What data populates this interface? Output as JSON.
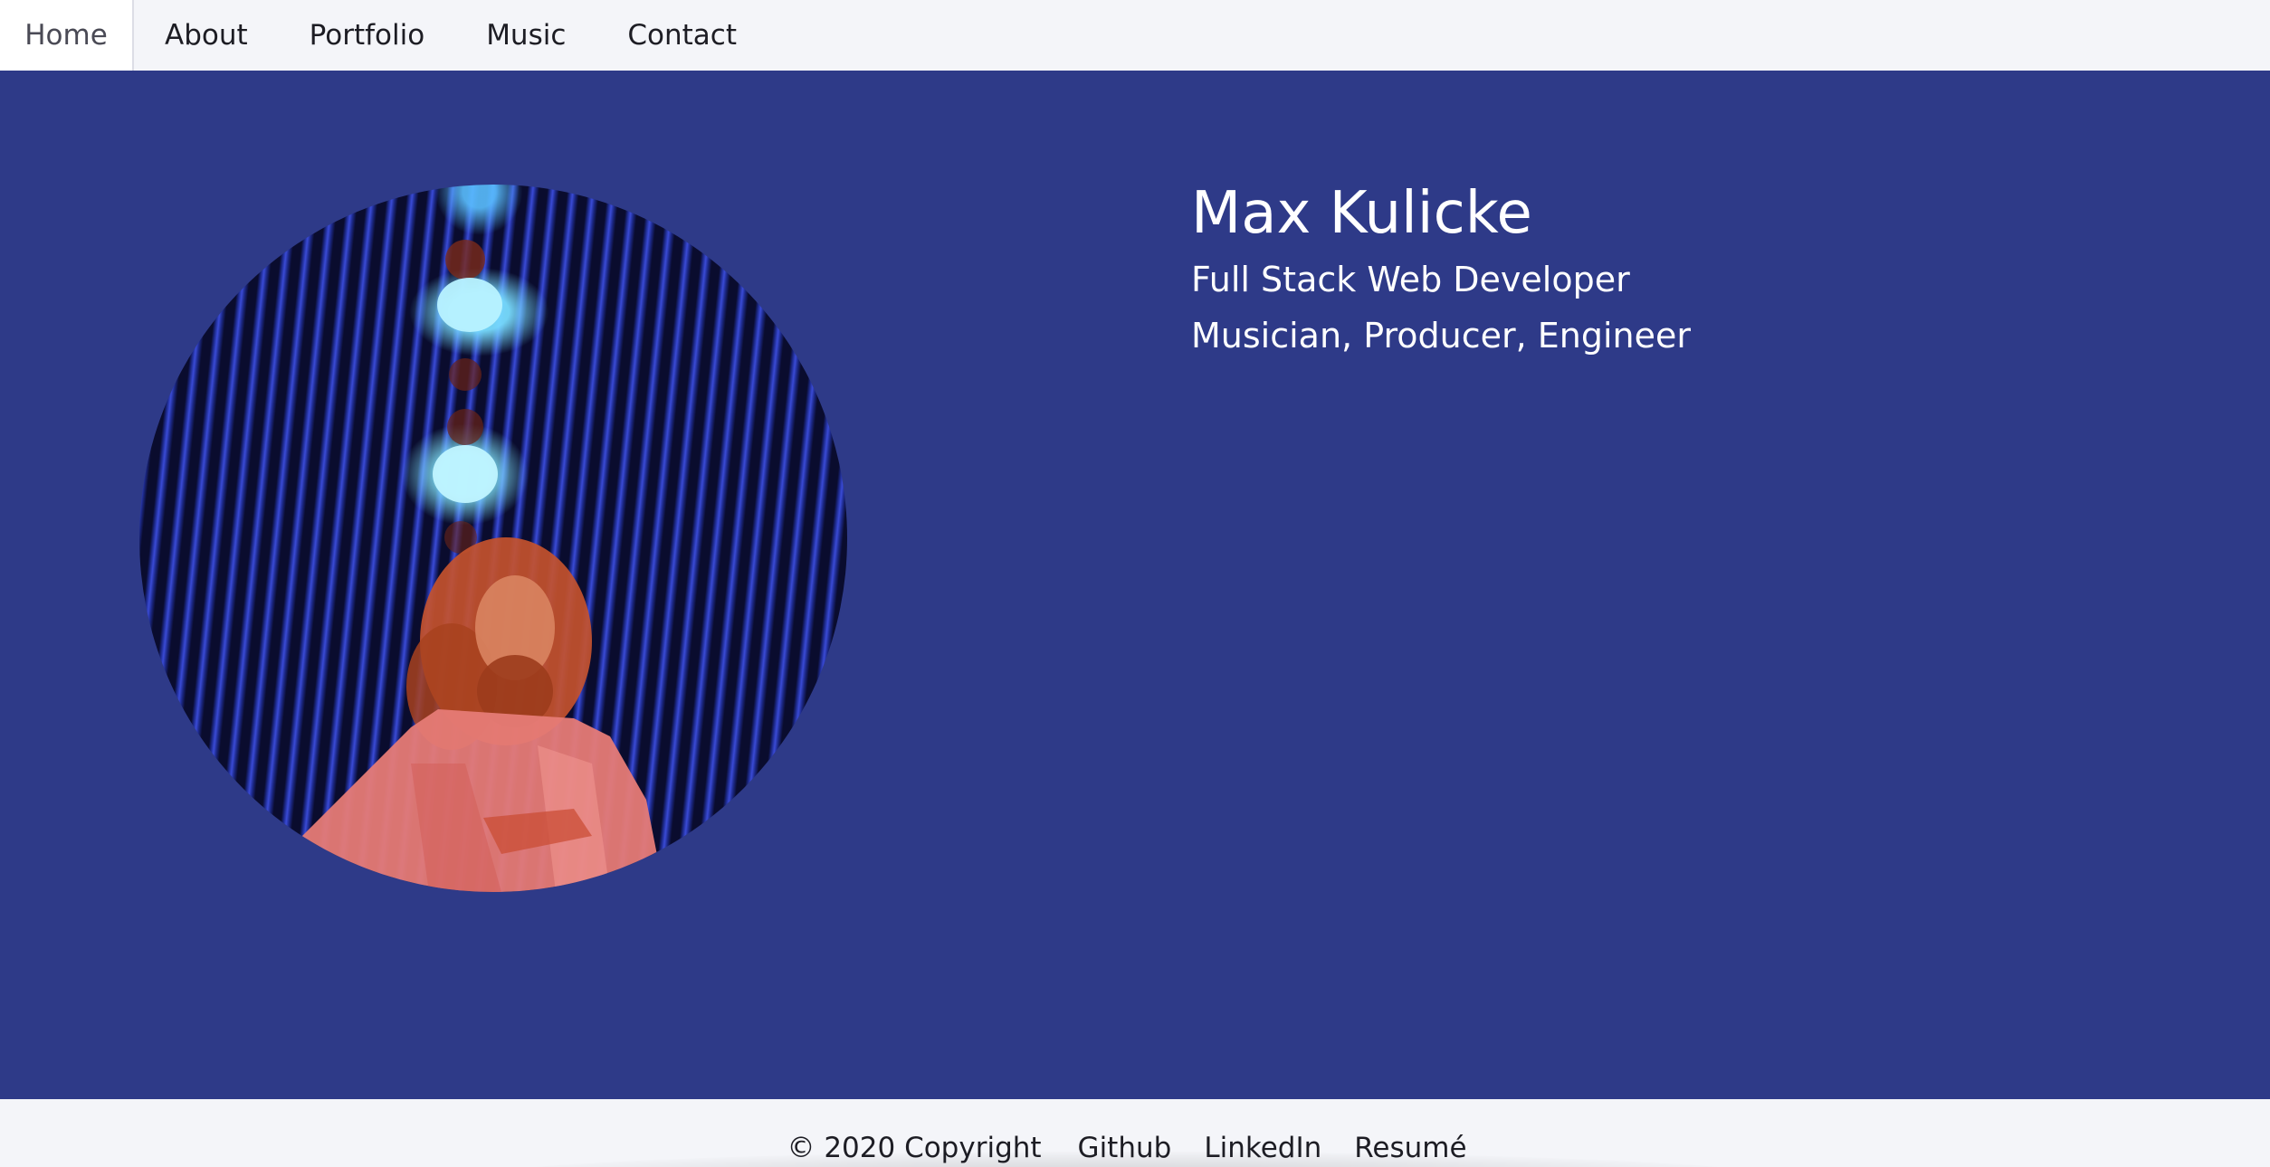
{
  "nav": {
    "items": [
      {
        "label": "Home",
        "active": true
      },
      {
        "label": "About",
        "active": false
      },
      {
        "label": "Portfolio",
        "active": false
      },
      {
        "label": "Music",
        "active": false
      },
      {
        "label": "Contact",
        "active": false
      }
    ]
  },
  "hero": {
    "name": "Max Kulicke",
    "roles": [
      "Full Stack Web Developer",
      "Musician, Producer, Engineer"
    ],
    "photo_icon": "profile-photo"
  },
  "footer": {
    "copyright": "© 2020 Copyright",
    "links": [
      "Github",
      "LinkedIn",
      "Resumé"
    ]
  },
  "colors": {
    "hero_background": "#2e3a88",
    "nav_background": "#f4f5f9",
    "text_light": "#ffffff",
    "text_dark": "#1d1d24"
  }
}
